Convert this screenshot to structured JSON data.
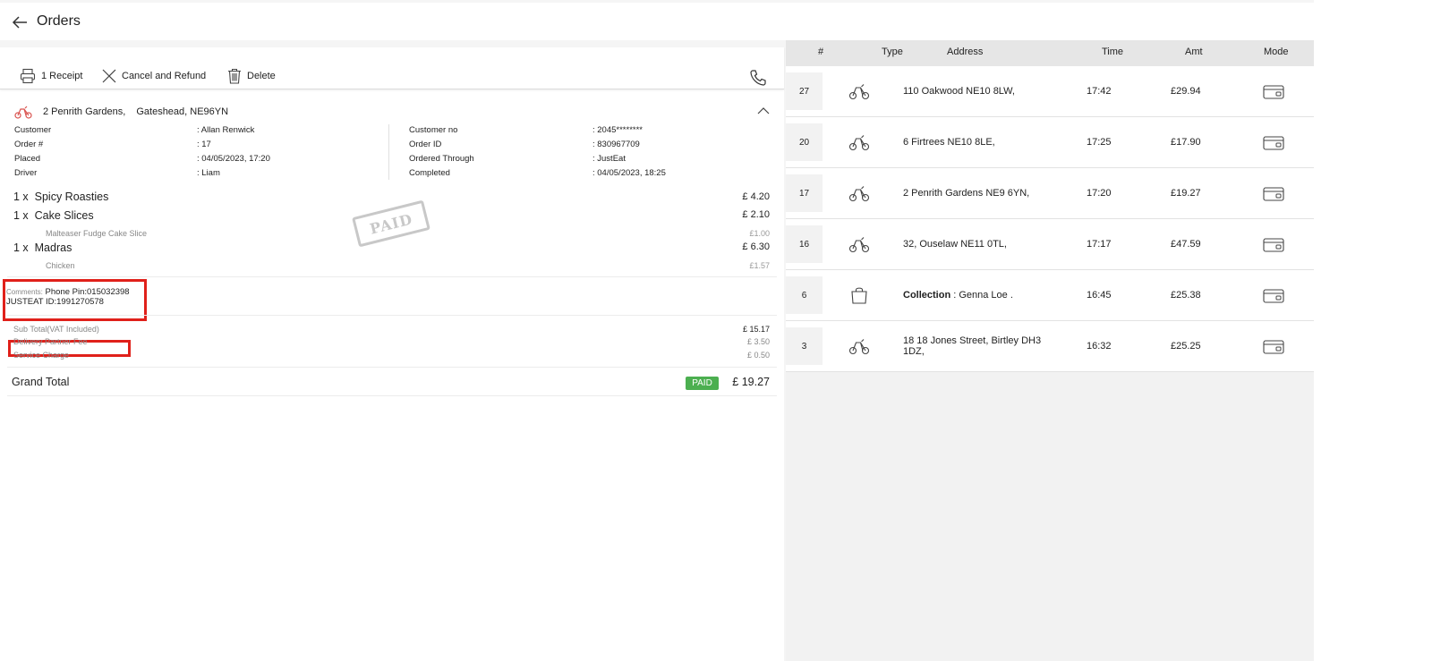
{
  "header": {
    "title": "Orders"
  },
  "toolbar": {
    "receipt_label": "1 Receipt",
    "cancel_refund_label": "Cancel and Refund",
    "delete_label": "Delete"
  },
  "order": {
    "address_line1": "2 Penrith Gardens,",
    "address_line2": "Gateshead, NE96YN",
    "info_left": [
      {
        "label": "Customer",
        "value": ": Allan Renwick"
      },
      {
        "label": "Order #",
        "value": ": 17"
      },
      {
        "label": "Placed",
        "value": ": 04/05/2023, 17:20"
      },
      {
        "label": "Driver",
        "value": ": Liam"
      }
    ],
    "info_right": [
      {
        "label": "Customer no",
        "value": ": 2045********"
      },
      {
        "label": "Order ID",
        "value": ": 830967709"
      },
      {
        "label": "Ordered Through",
        "value": ": JustEat"
      },
      {
        "label": "Completed",
        "value": ": 04/05/2023, 18:25"
      }
    ],
    "items": [
      {
        "qty": "1 x",
        "name": "Spicy Roasties",
        "price": "£ 4.20"
      },
      {
        "qty": "1 x",
        "name": "Cake Slices",
        "price": "£ 2.10",
        "sub": "Malteaser Fudge Cake Slice",
        "sub_price": "£1.00"
      },
      {
        "qty": "1 x",
        "name": "Madras",
        "price": "£ 6.30",
        "sub": "Chicken",
        "sub_price": "£1.57"
      }
    ],
    "stamp": "PAID",
    "comments_label": "Comments:",
    "comments_line1": "Phone Pin:015032398",
    "comments_line2": "JUSTEAT ID:1991270578",
    "summary": [
      {
        "label": "Sub Total(VAT Included)",
        "value": "£ 15.17"
      },
      {
        "label": "Delivery Partner Fee",
        "value": "£ 3.50"
      },
      {
        "label": "Service Charge",
        "value": "£ 0.50"
      }
    ],
    "grand_total_label": "Grand Total",
    "paid_badge": "PAID",
    "grand_total_value": "£ 19.27"
  },
  "orders_list": {
    "columns": [
      "#",
      "Type",
      "Address",
      "Time",
      "Amt",
      "Mode"
    ],
    "rows": [
      {
        "num": "27",
        "type": "delivery-scooter-icon",
        "address": "110 Oakwood NE10 8LW,",
        "time": "17:42",
        "amt": "£29.94",
        "mode": "card-icon"
      },
      {
        "num": "20",
        "type": "delivery-scooter-icon",
        "address": "6 Firtrees NE10 8LE,",
        "time": "17:25",
        "amt": "£17.90",
        "mode": "card-icon"
      },
      {
        "num": "17",
        "type": "delivery-scooter-icon",
        "address": "2 Penrith Gardens NE9 6YN,",
        "time": "17:20",
        "amt": "£19.27",
        "mode": "card-icon"
      },
      {
        "num": "16",
        "type": "delivery-scooter-icon",
        "address": "32, Ouselaw NE11 0TL,",
        "time": "17:17",
        "amt": "£47.59",
        "mode": "card-icon"
      },
      {
        "num": "6",
        "type": "shopping-bag-icon",
        "address_bold": "Collection",
        "address": " : Genna Loe .",
        "time": "16:45",
        "amt": "£25.38",
        "mode": "card-icon"
      },
      {
        "num": "3",
        "type": "delivery-scooter-icon",
        "address": "18 18 Jones Street, Birtley DH3",
        "address2": "1DZ,",
        "time": "16:32",
        "amt": "£25.25",
        "mode": "card-icon"
      }
    ]
  },
  "colors": {
    "accent_red": "#e0201a",
    "paid_green": "#4caf50",
    "scooter_icon_red": "#d9534f"
  }
}
